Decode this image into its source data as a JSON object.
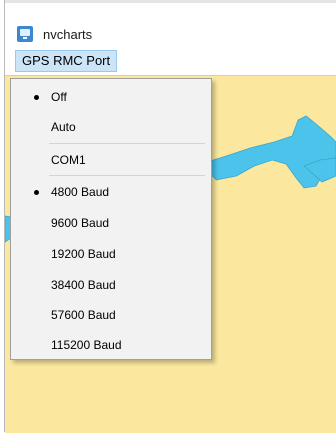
{
  "window": {
    "title": "nvcharts"
  },
  "menubar": {
    "active_menu": "GPS RMC Port"
  },
  "dropdown": {
    "mode_items": [
      {
        "label": "Off",
        "selected": true
      },
      {
        "label": "Auto",
        "selected": false
      }
    ],
    "port_items": [
      {
        "label": "COM1",
        "selected": false
      }
    ],
    "baud_items": [
      {
        "label": "4800 Baud",
        "selected": true
      },
      {
        "label": "9600 Baud",
        "selected": false
      },
      {
        "label": "19200 Baud",
        "selected": false
      },
      {
        "label": "38400 Baud",
        "selected": false
      },
      {
        "label": "57600 Baud",
        "selected": false
      },
      {
        "label": "115200 Baud",
        "selected": false
      }
    ]
  },
  "colors": {
    "land": "#fbe89e",
    "water": "#4cc3ea",
    "menu_highlight": "#cce4f7"
  },
  "icons": {
    "app": "app-window-icon",
    "selected_marker": "bullet-dot-icon"
  }
}
